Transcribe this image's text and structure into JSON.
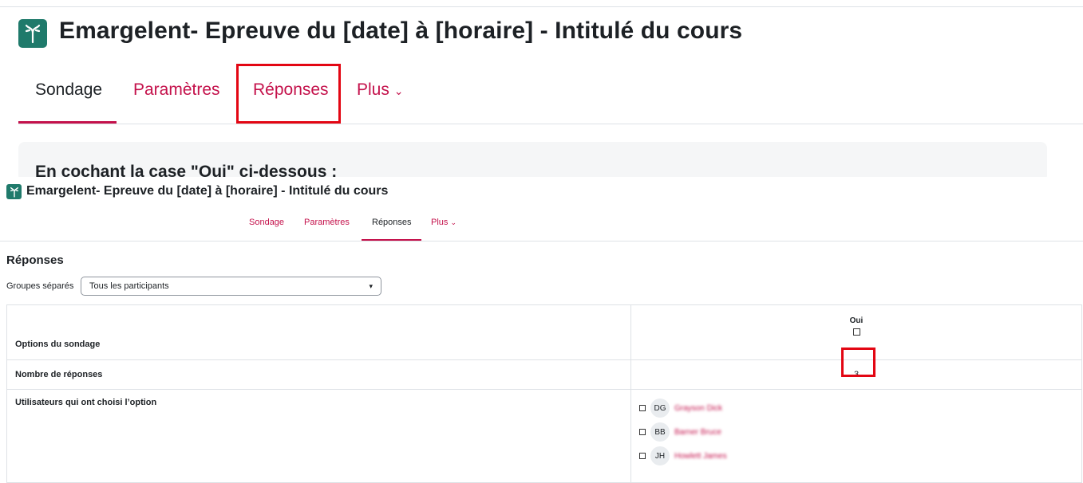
{
  "zoomed": {
    "title": "Emargelent- Epreuve du [date] à [horaire] - Intitulé du cours",
    "tabs": [
      {
        "label": "Sondage"
      },
      {
        "label": "Paramètres"
      },
      {
        "label": "Réponses"
      },
      {
        "label": "Plus"
      }
    ],
    "alert_text": "En cochant la case \"Oui\" ci-dessous :"
  },
  "page": {
    "title": "Emargelent- Epreuve du [date] à [horaire] - Intitulé du cours",
    "tabs": [
      {
        "label": "Sondage"
      },
      {
        "label": "Paramètres"
      },
      {
        "label": "Réponses"
      },
      {
        "label": "Plus"
      }
    ],
    "section_heading": "Réponses",
    "group_filter": {
      "label": "Groupes séparés",
      "selected": "Tous les participants"
    },
    "table": {
      "options_label": "Options du sondage",
      "option_name": "Oui",
      "count_label": "Nombre de réponses",
      "count_value": "3",
      "users_label": "Utilisateurs qui ont choisi l’option",
      "users": [
        {
          "initials": "DG",
          "name": "Grayson Dick"
        },
        {
          "initials": "BB",
          "name": "Barner Bruce"
        },
        {
          "initials": "JH",
          "name": "Howlett James"
        }
      ]
    }
  },
  "colors": {
    "accent": "#c4114b",
    "icon_bg": "#1f7a6b",
    "highlight_box": "#e30613"
  }
}
